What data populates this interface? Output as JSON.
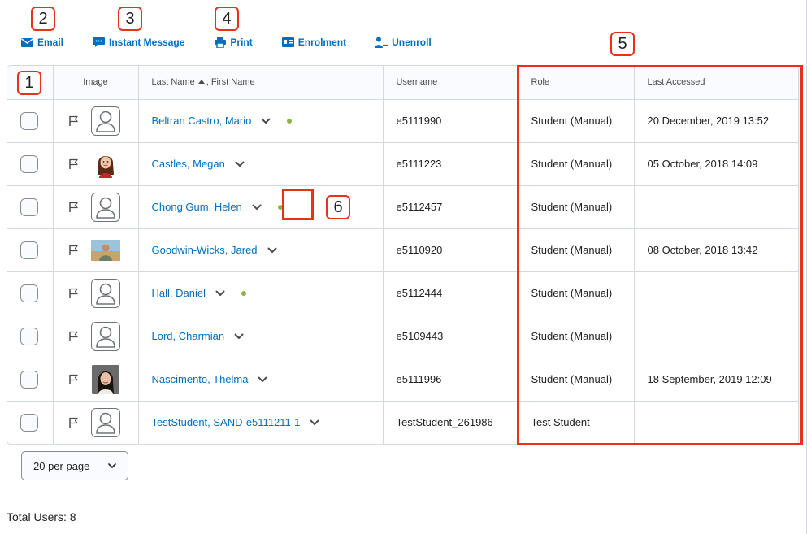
{
  "toolbar": {
    "email_label": "Email",
    "instant_message_label": "Instant Message",
    "print_label": "Print",
    "enrolment_label": "Enrolment",
    "unenroll_label": "Unenroll"
  },
  "callouts": {
    "c1": "1",
    "c2": "2",
    "c3": "3",
    "c4": "4",
    "c5": "5",
    "c6": "6"
  },
  "table": {
    "headers": {
      "image": "Image",
      "last_name": "Last Name",
      "first_name": ", First Name",
      "username": "Username",
      "role": "Role",
      "last_accessed": "Last Accessed"
    },
    "rows": [
      {
        "name": "Beltran Castro, Mario",
        "username": "e5111990",
        "role": "Student (Manual)",
        "last_accessed": "20 December, 2019 13:52",
        "avatar": "placeholder",
        "online": true
      },
      {
        "name": "Castles, Megan",
        "username": "e5111223",
        "role": "Student (Manual)",
        "last_accessed": "05 October, 2018 14:09",
        "avatar": "photo",
        "online": false
      },
      {
        "name": "Chong Gum, Helen",
        "username": "e5112457",
        "role": "Student (Manual)",
        "last_accessed": "",
        "avatar": "placeholder",
        "online": true
      },
      {
        "name": "Goodwin-Wicks, Jared",
        "username": "e5110920",
        "role": "Student (Manual)",
        "last_accessed": "08 October, 2018 13:42",
        "avatar": "photo",
        "online": false
      },
      {
        "name": "Hall, Daniel",
        "username": "e5112444",
        "role": "Student (Manual)",
        "last_accessed": "",
        "avatar": "placeholder",
        "online": true
      },
      {
        "name": "Lord, Charmian",
        "username": "e5109443",
        "role": "Student (Manual)",
        "last_accessed": "",
        "avatar": "placeholder",
        "online": false
      },
      {
        "name": "Nascimento, Thelma",
        "username": "e5111996",
        "role": "Student (Manual)",
        "last_accessed": "18 September, 2019 12:09",
        "avatar": "photo",
        "online": false
      },
      {
        "name": "TestStudent, SAND-e5111211-1",
        "username": "TestStudent_261986",
        "role": "Test Student",
        "last_accessed": "",
        "avatar": "placeholder",
        "online": false
      }
    ]
  },
  "pagination": {
    "per_page_label": "20 per page"
  },
  "footer": {
    "total_users": "Total Users: 8"
  },
  "colors": {
    "link": "#006fbf",
    "callout_red": "#e8301c",
    "online_dot": "#8ab63f",
    "border": "#d3d9e3"
  }
}
